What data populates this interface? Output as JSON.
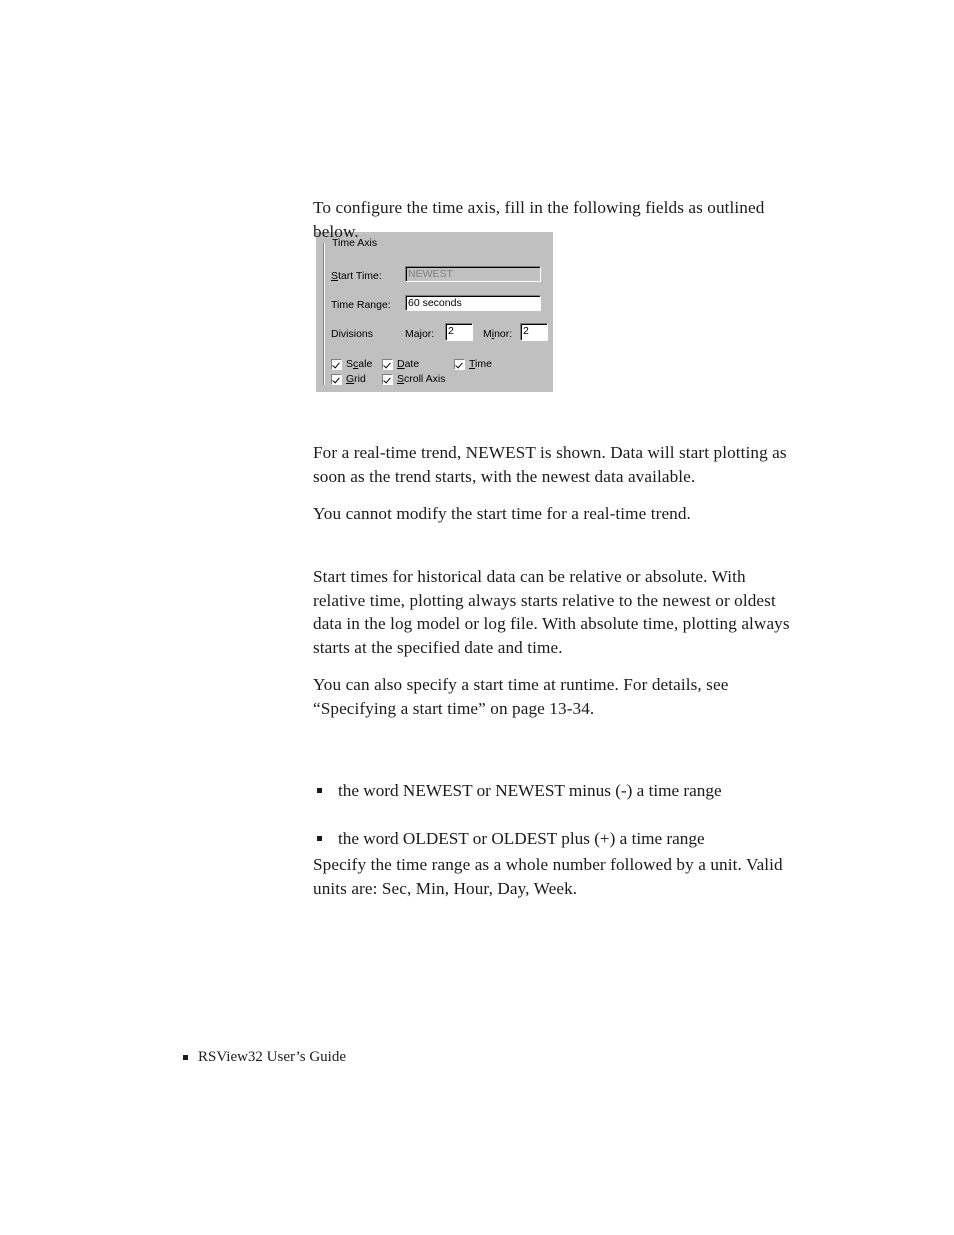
{
  "page": {
    "intro": "To configure the time axis, fill in the following fields as outlined below.",
    "paragraphs": {
      "realtime_1": "For a real-time trend, NEWEST is shown. Data will start plotting as soon as the trend starts, with the newest data available.",
      "realtime_2": "You cannot modify the start time for a real-time trend.",
      "historical_1": "Start times for historical data can be relative or absolute. With relative time, plotting always starts relative to the newest or oldest data in the log model or log file. With absolute time, plotting always starts at the specified date and time.",
      "historical_2": "You can also specify a start time at runtime. For details, see “Specifying a start time” on page 13-34.",
      "range_note": "Specify the time range as a whole number followed by a unit. Valid units are: Sec, Min, Hour, Day, Week."
    },
    "bullets": [
      "the word NEWEST or NEWEST minus (-) a time range",
      "the word OLDEST or OLDEST plus (+) a time range"
    ],
    "footer": {
      "text": "RSView32  User’s Guide"
    }
  },
  "dialog": {
    "group_title": "Time Axis",
    "fields": {
      "start_time": {
        "label_pre": "S",
        "label_post": "tart Time:",
        "value": "NEWEST",
        "disabled": true
      },
      "time_range": {
        "label": "Time Range:",
        "value": "60 seconds"
      },
      "divisions": {
        "label": "Divisions",
        "major": {
          "label_pre": "Ma",
          "label_accel": "j",
          "label_post": "or:",
          "value": "2"
        },
        "minor": {
          "label_pre": "M",
          "label_accel": "i",
          "label_post": "nor:",
          "value": "2"
        }
      }
    },
    "checkboxes": [
      {
        "id": "scale",
        "pre": "S",
        "accel": "c",
        "post": "ale",
        "checked": true
      },
      {
        "id": "date",
        "pre": "",
        "accel": "D",
        "post": "ate",
        "checked": true
      },
      {
        "id": "time",
        "pre": "",
        "accel": "T",
        "post": "ime",
        "checked": true
      },
      {
        "id": "grid",
        "pre": "",
        "accel": "G",
        "post": "rid",
        "checked": true
      },
      {
        "id": "scroll-axis",
        "pre": "",
        "accel": "S",
        "post": "croll Axis",
        "checked": true
      }
    ],
    "colors": {
      "face": "#c0c0c0",
      "shadow": "#808080",
      "highlight": "#ffffff",
      "text": "#000000",
      "disabled_text": "#808080"
    }
  }
}
